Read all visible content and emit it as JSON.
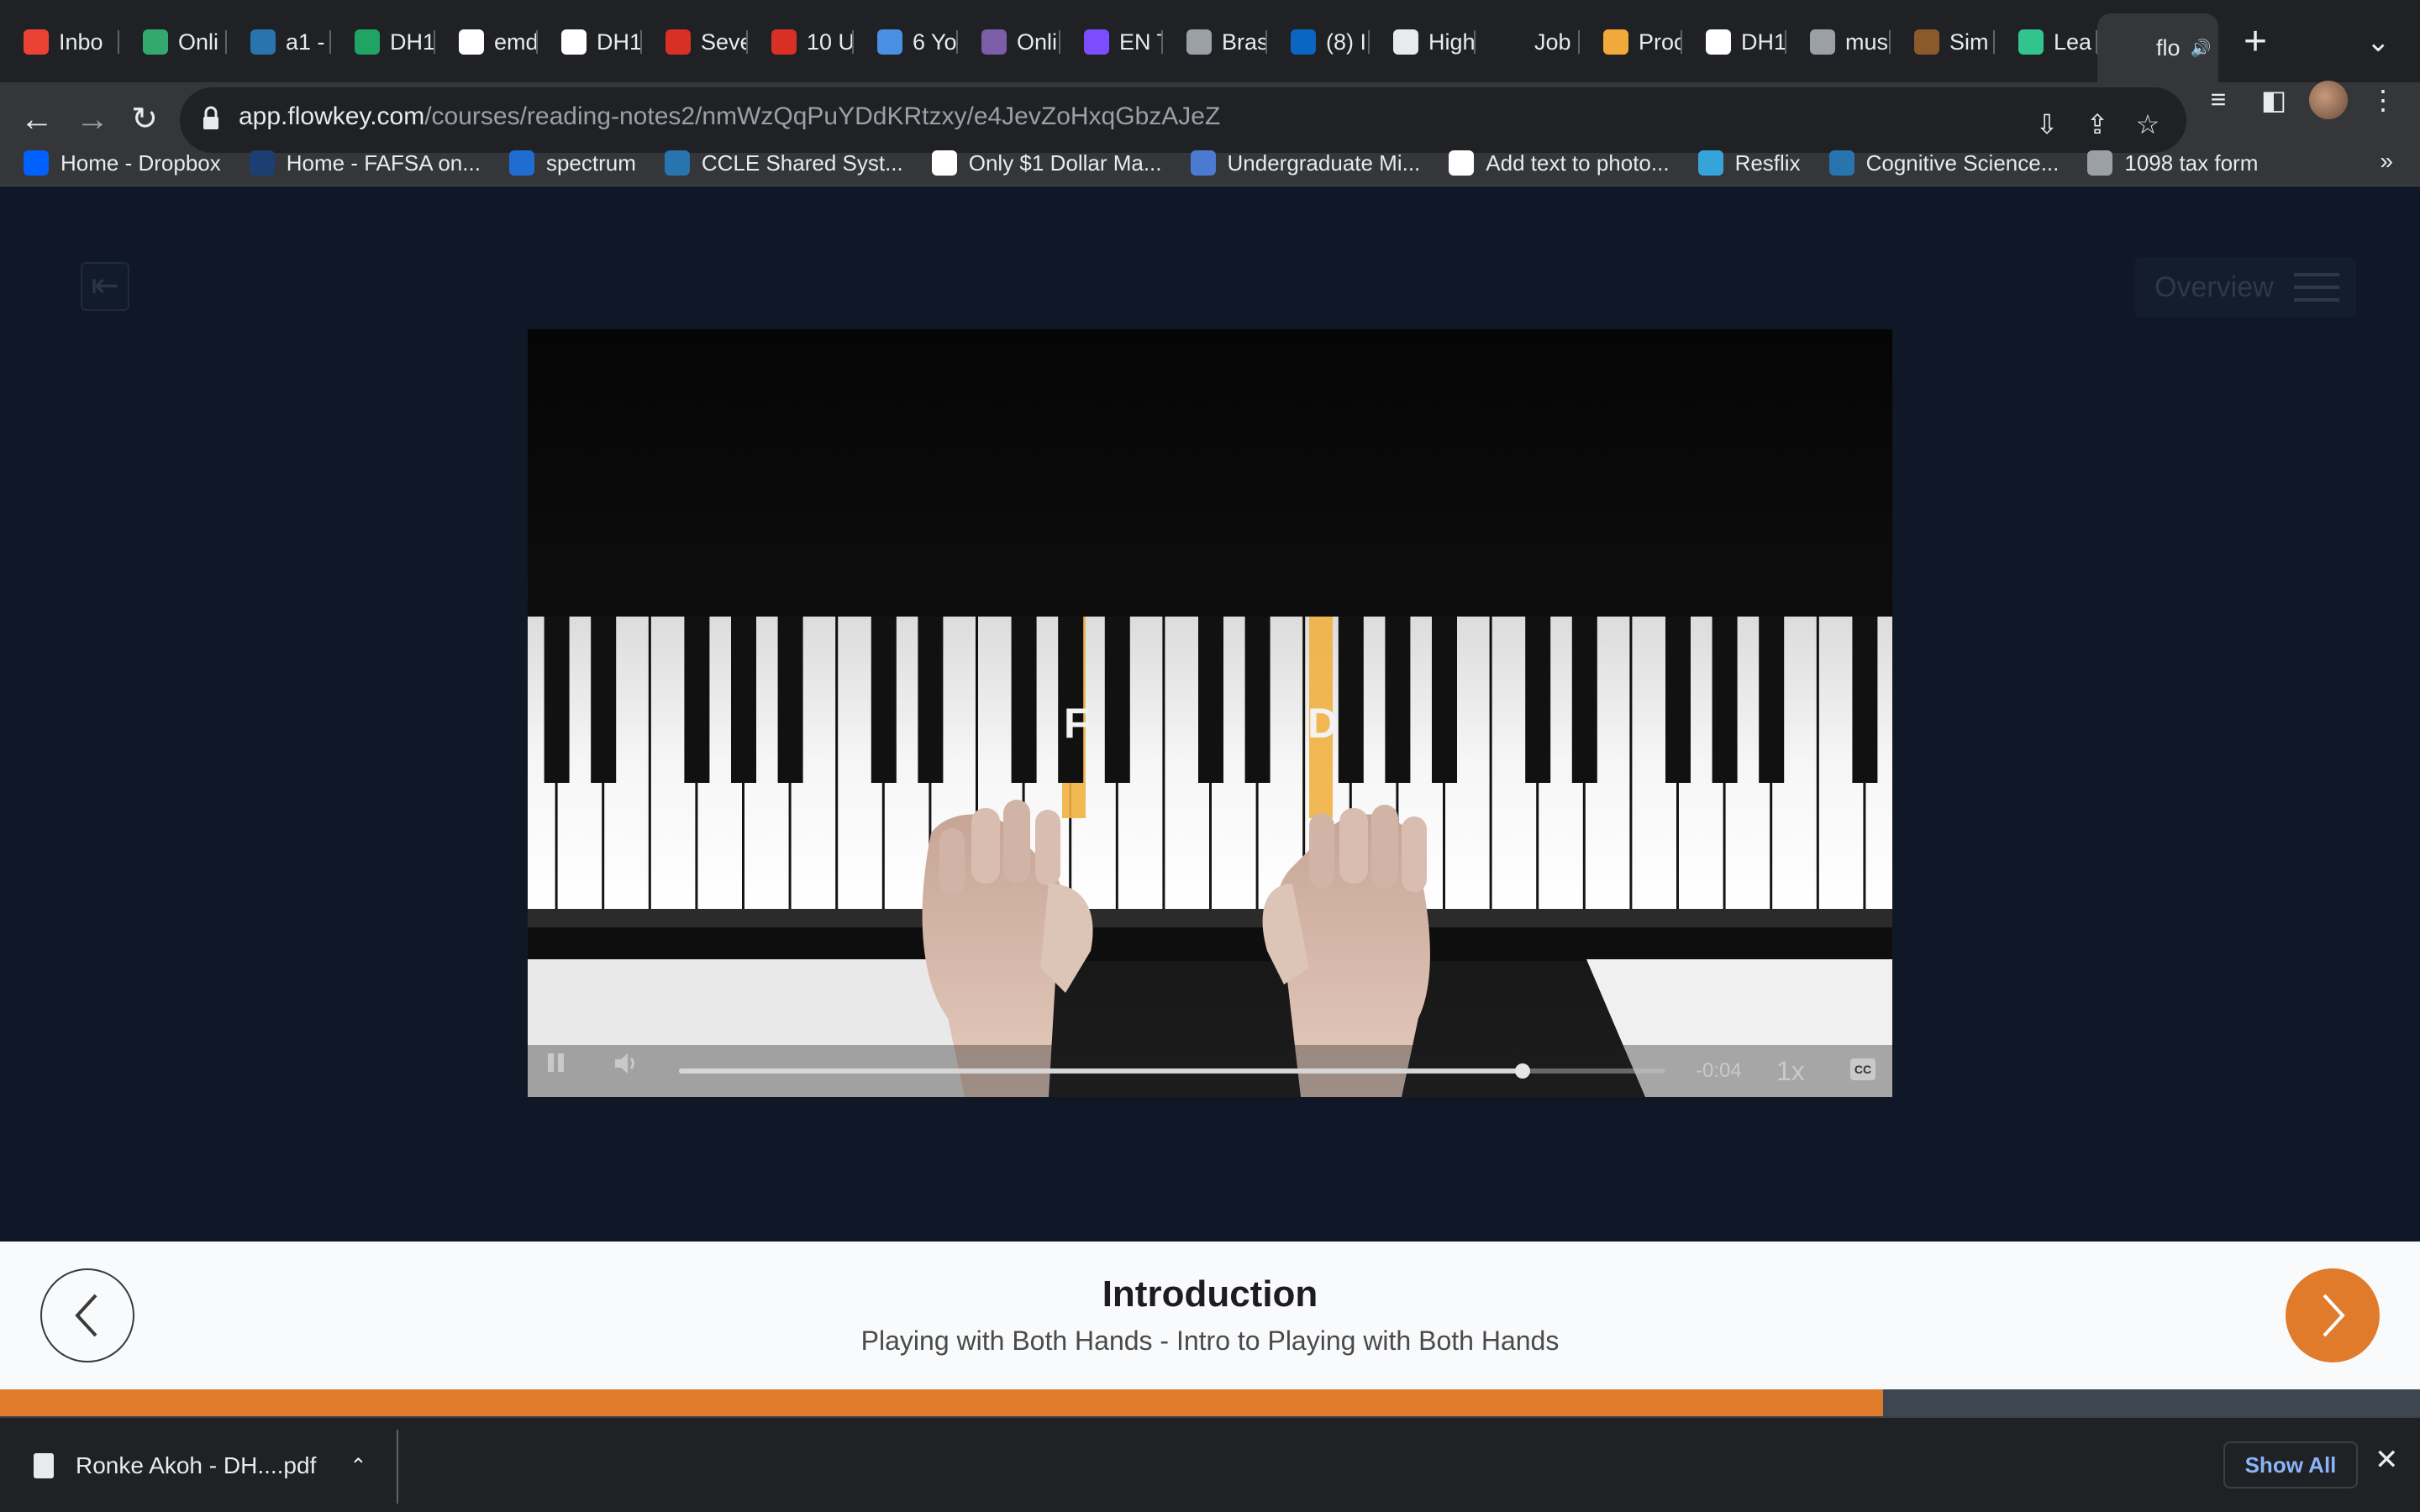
{
  "browser": {
    "tabs": [
      {
        "label": "Inbo",
        "icon": "gmail-icon",
        "color": "#ea4335"
      },
      {
        "label": "Onli",
        "icon": "online-icon",
        "color": "#35a870"
      },
      {
        "label": "a1 -",
        "icon": "ucla-icon",
        "color": "#2774ae"
      },
      {
        "label": "DH1",
        "icon": "google-drive-icon",
        "color": "#1fa463"
      },
      {
        "label": "emd",
        "icon": "github-icon",
        "color": "#ffffff"
      },
      {
        "label": "DH1",
        "icon": "github-icon",
        "color": "#ffffff"
      },
      {
        "label": "Seve",
        "icon": "notion-icon",
        "color": "#d93025"
      },
      {
        "label": "10 U",
        "icon": "notion-icon",
        "color": "#d93025"
      },
      {
        "label": "6 Yo",
        "icon": "grammarly-icon",
        "color": "#4a90e2"
      },
      {
        "label": "Onli",
        "icon": "online-icon",
        "color": "#7b5ea7"
      },
      {
        "label": "EN T",
        "icon": "play-icon",
        "color": "#7c4dff"
      },
      {
        "label": "Bras",
        "icon": "globe-icon",
        "color": "#9aa0a6"
      },
      {
        "label": "(8) I",
        "icon": "linkedin-icon",
        "color": "#0a66c2"
      },
      {
        "label": "High",
        "icon": "pen-icon",
        "color": "#e8eaed"
      },
      {
        "label": "Job",
        "icon": "apple-icon",
        "color": "#202124"
      },
      {
        "label": "Proc",
        "icon": "wave-icon",
        "color": "#f2a93b"
      },
      {
        "label": "DH1",
        "icon": "github-icon",
        "color": "#ffffff"
      },
      {
        "label": "mus",
        "icon": "music-icon",
        "color": "#9aa0a6"
      },
      {
        "label": "Sim",
        "icon": "clef-icon",
        "color": "#8b5a2b"
      },
      {
        "label": "Lea",
        "icon": "flowkey-icon",
        "color": "#32c48d"
      },
      {
        "label": "flo",
        "icon": "flowkey-icon",
        "color": "#35363a",
        "active": true
      }
    ],
    "url_host": "app.flowkey.com",
    "url_path": "/courses/reading-notes2/nmWzQqPuYDdKRtzxy/e4JevZoHxqGbzAJeZ",
    "bookmarks": [
      {
        "label": "Home - Dropbox",
        "icon": "dropbox-icon",
        "color": "#0061ff"
      },
      {
        "label": "Home - FAFSA on...",
        "icon": "fafsa-icon",
        "color": "#1b3f73"
      },
      {
        "label": "spectrum",
        "icon": "spectrum-icon",
        "color": "#1f6dd1"
      },
      {
        "label": "CCLE Shared Syst...",
        "icon": "ucla-icon",
        "color": "#2774ae"
      },
      {
        "label": "Only $1 Dollar Ma...",
        "icon": "a-icon",
        "color": "#ffffff"
      },
      {
        "label": "Undergraduate Mi...",
        "icon": "dh-icon",
        "color": "#4a7bd1"
      },
      {
        "label": "Add text to photo...",
        "icon": "p-icon",
        "color": "#ffffff"
      },
      {
        "label": "Resflix",
        "icon": "resflix-icon",
        "color": "#35a4d9"
      },
      {
        "label": "Cognitive Science...",
        "icon": "psi-icon",
        "color": "#2774ae"
      },
      {
        "label": "1098 tax form",
        "icon": "globe-icon",
        "color": "#9aa0a6"
      }
    ]
  },
  "app": {
    "overview_label": "Overview",
    "video": {
      "note_labels": [
        "F",
        "D"
      ],
      "time_remaining": "-0:04",
      "speed": "1x",
      "cc_label": "CC",
      "progress": 0.855
    },
    "lesson": {
      "title": "Introduction",
      "subtitle": "Playing with Both Hands - Intro to Playing with Both Hands",
      "course_progress": 0.778
    },
    "accent_color": "#e07b2c"
  },
  "downloads": {
    "file_name": "Ronke Akoh - DH....pdf",
    "show_all_label": "Show All"
  }
}
